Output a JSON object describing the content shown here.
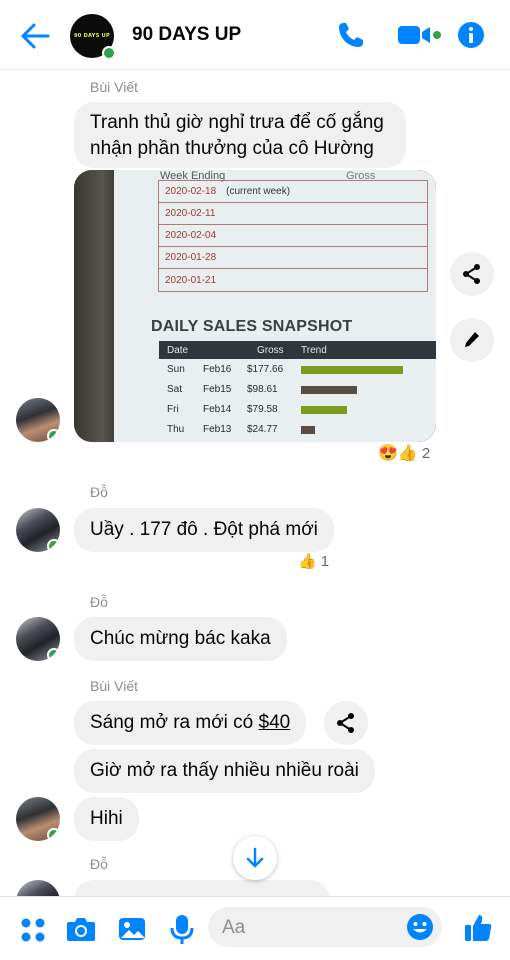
{
  "header": {
    "title": "90 DAYS UP",
    "logo_text": "90 DAYS UP"
  },
  "messages": {
    "m1_sender": "Bùi Viết",
    "m1_line1": "Tranh thủ giờ nghỉ trưa để cố gắng",
    "m1_line2": "nhận phần thưởng của cô Hường",
    "photo": {
      "week_header": "Week Ending",
      "gross_header": "Gross",
      "weeks": [
        "2020-02-18",
        "2020-02-11",
        "2020-02-04",
        "2020-01-28",
        "2020-01-21"
      ],
      "current_week": "(current week)",
      "snapshot_title": "DAILY SALES SNAPSHOT",
      "cols": [
        "Date",
        "Gross",
        "Trend"
      ],
      "rows": [
        {
          "day": "Sun",
          "date": "Feb16",
          "gross": "$177.66",
          "trend": 1.0,
          "color": "#7a9a1c"
        },
        {
          "day": "Sat",
          "date": "Feb15",
          "gross": "$98.61",
          "trend": 0.55,
          "color": "#5a4e44"
        },
        {
          "day": "Fri",
          "date": "Feb14",
          "gross": "$79.58",
          "trend": 0.45,
          "color": "#7a9a1c"
        },
        {
          "day": "Thu",
          "date": "Feb13",
          "gross": "$24.77",
          "trend": 0.14,
          "color": "#5a4e44"
        }
      ]
    },
    "photo_reaction_count": "2",
    "m2_sender": "Đỗ",
    "m2_text": "Uầy . 177 đô . Đột phá mới",
    "m2_reaction_count": "1",
    "m3_sender": "Đỗ",
    "m3_text": "Chúc mừng bác kaka",
    "m4_sender": "Bùi Viết",
    "m4_text_before": "Sáng mở ra mới có ",
    "m4_link": "$40",
    "m5_text": "Giờ mở ra thấy nhiều nhiều roài",
    "m6_text": "Hihi",
    "m7_sender": "Đỗ"
  },
  "composer": {
    "placeholder": "Aa"
  },
  "colors": {
    "accent": "#0084ff",
    "online": "#31a24c",
    "bubble": "#f0f0f0"
  },
  "icons": [
    "back-arrow-icon",
    "phone-icon",
    "video-call-icon",
    "info-icon",
    "share-icon",
    "edit-icon",
    "scroll-down-icon",
    "apps-icon",
    "camera-icon",
    "gallery-icon",
    "microphone-icon",
    "emoji-icon",
    "like-icon"
  ]
}
